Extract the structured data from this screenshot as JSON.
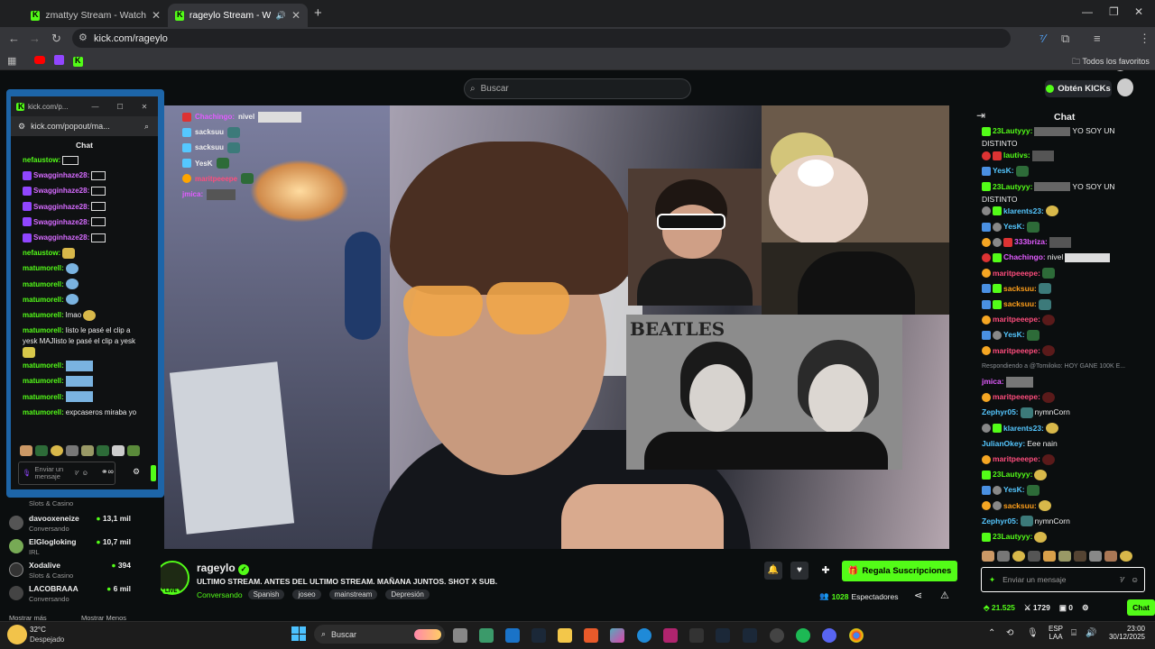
{
  "tabs": [
    {
      "title": "zmattyy Stream - Watch Live on"
    },
    {
      "title": "rageylo Stream - Watch Live"
    }
  ],
  "address_url": "kick.com/rageylo",
  "bookmarks": {
    "all_label": "Todos los favoritos"
  },
  "kick": {
    "search_placeholder": "Buscar",
    "get_kicks": "Obtén KICKs"
  },
  "popout": {
    "title": "kick.com/p...",
    "url": "kick.com/popout/ma...",
    "chat_title": "Chat",
    "input_placeholder": "Enviar un mensaje",
    "messages": [
      {
        "user": "nefaustow:",
        "text": "",
        "color": "#53fc18"
      },
      {
        "user": "Swagginhaze28:",
        "text": "",
        "color": "#d66bff"
      },
      {
        "user": "Swagginhaze28:",
        "text": "",
        "color": "#d66bff"
      },
      {
        "user": "Swagginhaze28:",
        "text": "",
        "color": "#d66bff"
      },
      {
        "user": "Swagginhaze28:",
        "text": "",
        "color": "#d66bff"
      },
      {
        "user": "Swagginhaze28:",
        "text": "",
        "color": "#d66bff"
      },
      {
        "user": "nefaustow:",
        "text": "",
        "color": "#53fc18"
      },
      {
        "user": "matumorell:",
        "text": "",
        "color": "#53fc18"
      },
      {
        "user": "matumorell:",
        "text": "",
        "color": "#53fc18"
      },
      {
        "user": "matumorell:",
        "text": "",
        "color": "#53fc18"
      },
      {
        "user": "matumorell:",
        "text": "lmao",
        "color": "#53fc18"
      },
      {
        "user": "matumorell:",
        "text": "listo le pasé el clip a",
        "color": "#53fc18"
      },
      {
        "user": "",
        "text": "yesk MAJlisto le pasé el clip a yesk",
        "color": "#ffffff"
      },
      {
        "user": "",
        "text": "",
        "color": "#ffffff"
      },
      {
        "user": "matumorell:",
        "text": "",
        "color": "#53fc18"
      },
      {
        "user": "matumorell:",
        "text": "",
        "color": "#53fc18"
      },
      {
        "user": "matumorell:",
        "text": "",
        "color": "#53fc18"
      },
      {
        "user": "matumorell:",
        "text": "expcaseros miraba yo",
        "color": "#53fc18"
      }
    ]
  },
  "sidebar": {
    "items": [
      {
        "name": "",
        "category": "Slots & Casino",
        "viewers": ""
      },
      {
        "name": "davooxeneize",
        "category": "Conversando",
        "viewers": "13,1 mil"
      },
      {
        "name": "ElGlogloking",
        "category": "IRL",
        "viewers": "10,7 mil"
      },
      {
        "name": "Xodalive",
        "category": "Slots & Casino",
        "viewers": "394"
      },
      {
        "name": "LACOBRAAA",
        "category": "Conversando",
        "viewers": "6 mil"
      }
    ],
    "show_more": "Mostrar más",
    "show_less": "Mostrar Menos"
  },
  "video_overlay_chat": [
    {
      "user": "Chachingo:",
      "text": "nivel",
      "color": "#e25cff"
    },
    {
      "user": "sacksuu",
      "text": "",
      "color": "#55c7ff"
    },
    {
      "user": "sacksuu",
      "text": "",
      "color": "#55c7ff"
    },
    {
      "user": "YesK",
      "text": "",
      "color": "#55c7ff"
    },
    {
      "user": "maritpeeepe",
      "text": "",
      "color": "#ff4d7d"
    },
    {
      "user": "jmica:",
      "text": "",
      "color": "#e25cff"
    }
  ],
  "video_text": {
    "beatles_sign": "BEATLES"
  },
  "stream": {
    "streamer": "rageylo",
    "live_badge": "LIVE",
    "title": "ULTIMO STREAM. ANTES DEL ULTIMO STREAM. MAÑANA JUNTOS. SHOT X SUB.",
    "category": "Conversando",
    "tags": [
      "Spanish",
      "joseo",
      "mainstream",
      "Depresión"
    ],
    "gift_subs": "Regala Suscripciones",
    "viewers": "1028",
    "viewers_label": "Espectadores"
  },
  "chat": {
    "title": "Chat",
    "messages": [
      {
        "user": "23Lautyyy:",
        "text": "YO SOY UN",
        "color": "#53fc18"
      },
      {
        "user": "",
        "text": "DISTINTO",
        "color": "#ffffff"
      },
      {
        "user": "lautivs:",
        "text": "",
        "color": "#53fc18"
      },
      {
        "user": "YesK:",
        "text": "",
        "color": "#55c7ff"
      },
      {
        "user": "23Lautyyy:",
        "text": "YO SOY UN",
        "color": "#53fc18"
      },
      {
        "user": "",
        "text": "DISTINTO",
        "color": "#ffffff"
      },
      {
        "user": "klarents23:",
        "text": "",
        "color": "#55c7ff"
      },
      {
        "user": "YesK:",
        "text": "",
        "color": "#55c7ff"
      },
      {
        "user": "333briza:",
        "text": "",
        "color": "#e25cff"
      },
      {
        "user": "Chachingo:",
        "text": "nivel",
        "color": "#e25cff"
      },
      {
        "user": "maritpeeepe:",
        "text": "",
        "color": "#ff4d7d"
      },
      {
        "user": "sacksuu:",
        "text": "",
        "color": "#ff9f1a"
      },
      {
        "user": "sacksuu:",
        "text": "",
        "color": "#ff9f1a"
      },
      {
        "user": "maritpeeepe:",
        "text": "",
        "color": "#ff4d7d"
      },
      {
        "user": "YesK:",
        "text": "",
        "color": "#55c7ff"
      },
      {
        "user": "maritpeeepe:",
        "text": "",
        "color": "#ff4d7d"
      },
      {
        "user": "",
        "text": "Respondiendo a @Tomiloko: HOY GANE 100K E...",
        "color": "#8a8f94"
      },
      {
        "user": "jmica:",
        "text": "",
        "color": "#e25cff"
      },
      {
        "user": "maritpeeepe:",
        "text": "",
        "color": "#ff4d7d"
      },
      {
        "user": "Zephyr05:",
        "text": "nymnCorn",
        "color": "#55c7ff"
      },
      {
        "user": "klarents23:",
        "text": "",
        "color": "#55c7ff"
      },
      {
        "user": "JulianOkey:",
        "text": "Eee nain",
        "color": "#55c7ff"
      },
      {
        "user": "maritpeeepe:",
        "text": "",
        "color": "#ff4d7d"
      },
      {
        "user": "23Lautyyy:",
        "text": "",
        "color": "#53fc18"
      },
      {
        "user": "YesK:",
        "text": "",
        "color": "#55c7ff"
      },
      {
        "user": "sacksuu:",
        "text": "",
        "color": "#ff9f1a"
      },
      {
        "user": "Zephyr05:",
        "text": "nymnCorn",
        "color": "#55c7ff"
      },
      {
        "user": "23Lautyyy:",
        "text": "",
        "color": "#53fc18"
      }
    ],
    "input_placeholder": "Enviar un mensaje",
    "points": "21.525",
    "stat_1": "1729",
    "stat_2": "0",
    "send_label": "Chat"
  },
  "taskbar": {
    "weather_temp": "32°C",
    "weather_desc": "Despejado",
    "search_label": "Buscar",
    "lang": "ESP",
    "lang_sub": "LAA",
    "time": "23:00",
    "date": "30/12/2025"
  },
  "colors": {
    "kick_green": "#53fc18",
    "popout_border": "#1d65a8"
  }
}
